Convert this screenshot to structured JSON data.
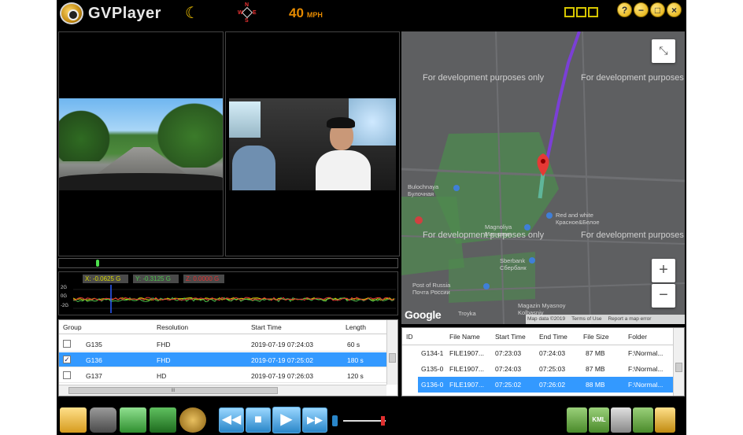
{
  "app": {
    "title": "GVPlayer",
    "speed_value": "40",
    "speed_unit": "MPH",
    "compass": {
      "n": "N",
      "s": "S",
      "e": "E",
      "w": "W"
    },
    "win_buttons": [
      "?",
      "−",
      "□",
      "×"
    ]
  },
  "gsensor": {
    "x_label": "X: -0.0625 G",
    "y_label": "Y: -0.3125 G",
    "z_label": "Z: 0.0000 G",
    "axis_labels": [
      "2G",
      "0G",
      "-2G"
    ]
  },
  "map": {
    "watermark": "For development purposes only",
    "attribution": [
      "Map data ©2019",
      "Terms of Use",
      "Report a map error"
    ],
    "google": "Google",
    "zoom_in": "+",
    "zoom_out": "−",
    "labels": [
      {
        "text": "Bulochnaya",
        "sub": "Булочная"
      },
      {
        "text": "Magnoliya",
        "sub": "Магнолия"
      },
      {
        "text": "Red and white",
        "sub": "Красное&Белое"
      },
      {
        "text": "Sberbank",
        "sub": "Сбербанк"
      },
      {
        "text": "Post of Russia",
        "sub": "Почта России"
      },
      {
        "text": "Magazin Myasnoy",
        "sub": "Kolbasniy"
      },
      {
        "text": "Troyka",
        "sub": ""
      }
    ]
  },
  "group_table": {
    "headers": [
      "Group",
      "Resolution",
      "Start Time",
      "Length"
    ],
    "rows": [
      {
        "group": "G135",
        "resolution": "FHD",
        "start": "2019-07-19 07:24:03",
        "length": "60 s",
        "checked": "",
        "selected": false
      },
      {
        "group": "G136",
        "resolution": "FHD",
        "start": "2019-07-19 07:25:02",
        "length": "180 s",
        "checked": "✓",
        "selected": true
      },
      {
        "group": "G137",
        "resolution": "HD",
        "start": "2019-07-19 07:26:03",
        "length": "120 s",
        "checked": "",
        "selected": false
      }
    ],
    "hscroll_label": "III"
  },
  "file_table": {
    "headers": [
      "ID",
      "File Name",
      "Start Time",
      "End Time",
      "File Size",
      "Folder"
    ],
    "rows": [
      {
        "id": "G134-1",
        "name": "FILE1907...",
        "start": "07:23:03",
        "end": "07:24:03",
        "size": "87 MB",
        "folder": "F:\\Normal...",
        "selected": false
      },
      {
        "id": "G135-0",
        "name": "FILE1907...",
        "start": "07:24:03",
        "end": "07:25:03",
        "size": "87 MB",
        "folder": "F:\\Normal...",
        "selected": false
      },
      {
        "id": "G136-0",
        "name": "FILE1907...",
        "start": "07:25:02",
        "end": "07:26:02",
        "size": "88 MB",
        "folder": "F:\\Normal...",
        "selected": true
      }
    ]
  },
  "toolbar": {
    "rewind": "◀◀",
    "stop": "■",
    "play": "▶",
    "forward": "▶▶",
    "kml_label": "KML"
  },
  "colors": {
    "accent_blue": "#3399ff",
    "speed_orange": "#e58a00",
    "gx": "#d8d800",
    "gy": "#4cc24c",
    "gz": "#e03030",
    "route_purple": "#7b3fd6",
    "route_teal": "#5fb69a",
    "pin_red": "#e53935"
  }
}
